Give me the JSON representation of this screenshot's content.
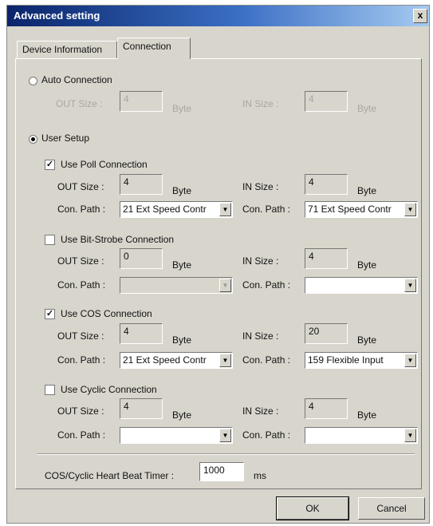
{
  "window": {
    "title": "Advanced setting",
    "close_glyph": "x"
  },
  "tabs": [
    {
      "label": "Device Information",
      "active": false
    },
    {
      "label": "Connection",
      "active": true
    }
  ],
  "auto": {
    "label": "Auto Connection",
    "selected": false,
    "out_label": "OUT Size :",
    "out_value": "4",
    "in_label": "IN Size :",
    "in_value": "4",
    "unit": "Byte"
  },
  "user_setup": {
    "label": "User Setup",
    "selected": true
  },
  "poll": {
    "label": "Use Poll Connection",
    "checked": true,
    "out_label": "OUT Size :",
    "out_value": "4",
    "in_label": "IN Size :",
    "in_value": "4",
    "unit": "Byte",
    "path_label": "Con. Path :",
    "out_path": "21 Ext Speed Contr",
    "in_path": "71 Ext Speed Contr"
  },
  "bitstrobe": {
    "label": "Use Bit-Strobe Connection",
    "checked": false,
    "out_label": "OUT Size :",
    "out_value": "0",
    "in_label": "IN Size :",
    "in_value": "4",
    "unit": "Byte",
    "path_label": "Con. Path :",
    "out_path": "",
    "in_path": ""
  },
  "cos": {
    "label": "Use COS Connection",
    "checked": true,
    "out_label": "OUT Size :",
    "out_value": "4",
    "in_label": "IN Size :",
    "in_value": "20",
    "unit": "Byte",
    "path_label": "Con. Path :",
    "out_path": "21 Ext Speed Contr",
    "in_path": "159 Flexible Input"
  },
  "cyclic": {
    "label": "Use Cyclic Connection",
    "checked": false,
    "out_label": "OUT Size :",
    "out_value": "4",
    "in_label": "IN Size :",
    "in_value": "4",
    "unit": "Byte",
    "path_label": "Con. Path :",
    "out_path": "",
    "in_path": ""
  },
  "heartbeat": {
    "label": "COS/Cyclic Heart Beat Timer :",
    "value": "1000",
    "unit": "ms"
  },
  "buttons": {
    "ok": "OK",
    "cancel": "Cancel"
  },
  "icons": {
    "dropdown": "chevron-down-icon",
    "check": "checkmark-icon"
  },
  "colors": {
    "title_start": "#0a246a",
    "title_end": "#a6caf0",
    "face": "#d8d5cc"
  }
}
